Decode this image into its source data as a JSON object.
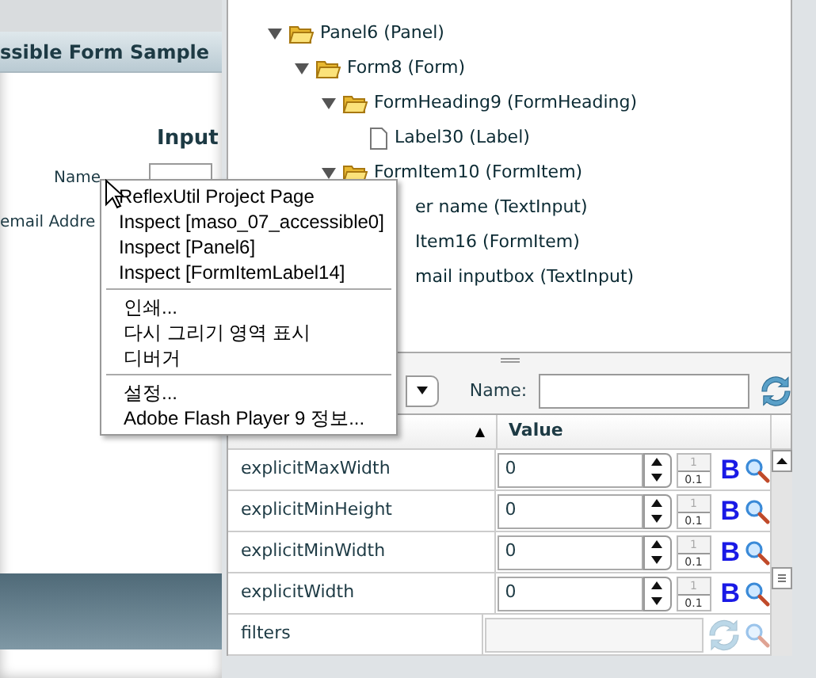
{
  "app": {
    "title": "ssible Form Sample",
    "heading": "Input",
    "fields": [
      {
        "label": "Name"
      },
      {
        "label": "email Addre"
      }
    ]
  },
  "tree": [
    {
      "label": "Panel6 (Panel)",
      "kind": "folder",
      "expanded": true,
      "children": [
        {
          "label": "Form8 (Form)",
          "kind": "folder",
          "expanded": true,
          "children": [
            {
              "label": "FormHeading9 (FormHeading)",
              "kind": "folder",
              "expanded": true,
              "children": [
                {
                  "label": "Label30 (Label)",
                  "kind": "file"
                }
              ]
            },
            {
              "label": "FormItem10 (FormItem)",
              "kind": "folder",
              "expanded": true,
              "children": [
                {
                  "label": "er name (TextInput)",
                  "kind": "clipped"
                }
              ]
            },
            {
              "label": "Item16 (FormItem)",
              "kind": "clipped",
              "children": [
                {
                  "label": "mail inputbox (TextInput)",
                  "kind": "clipped"
                }
              ]
            }
          ]
        }
      ]
    }
  ],
  "toolbar": {
    "name_label": "Name:"
  },
  "table": {
    "columns": [
      {
        "label": "Value"
      }
    ],
    "sort": "▲",
    "rows": [
      {
        "name": "explicitMaxWidth",
        "value": "0",
        "kind": "number",
        "step_large": "1",
        "step_small": "0.1",
        "bind": "B"
      },
      {
        "name": "explicitMinHeight",
        "value": "0",
        "kind": "number",
        "step_large": "1",
        "step_small": "0.1",
        "bind": "B"
      },
      {
        "name": "explicitMinWidth",
        "value": "0",
        "kind": "number",
        "step_large": "1",
        "step_small": "0.1",
        "bind": "B"
      },
      {
        "name": "explicitWidth",
        "value": "0",
        "kind": "number",
        "step_large": "1",
        "step_small": "0.1",
        "bind": "B"
      },
      {
        "name": "filters",
        "kind": "object"
      }
    ]
  },
  "context_menu": {
    "groups": [
      [
        "ReflexUtil Project Page",
        "Inspect [maso_07_accessible0]",
        "Inspect [Panel6]",
        "Inspect [FormItemLabel14]"
      ],
      [
        "인쇄...",
        "다시 그리기 영역 표시",
        "디버거"
      ],
      [
        "설정...",
        "Adobe Flash Player 9 정보..."
      ]
    ]
  }
}
